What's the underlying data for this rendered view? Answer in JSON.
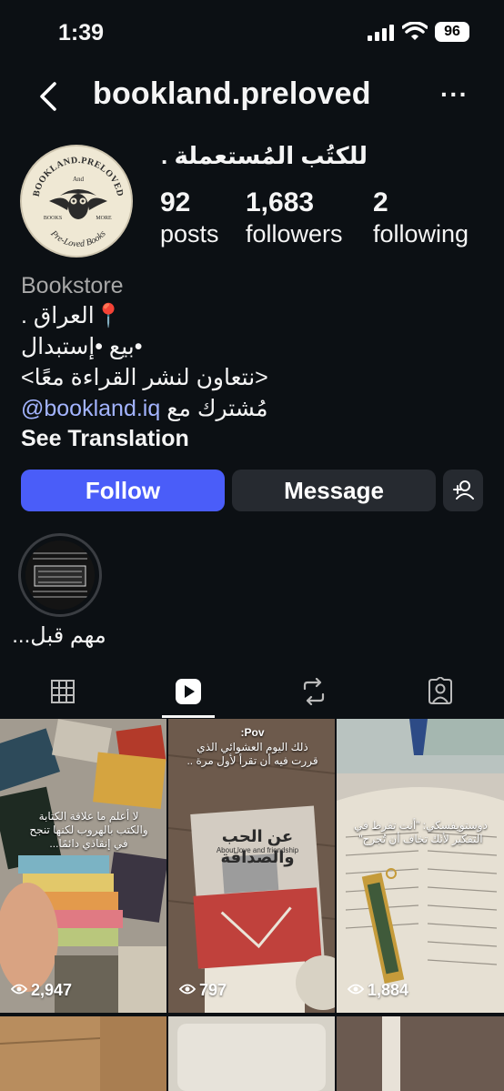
{
  "status": {
    "time": "1:39",
    "battery": "96"
  },
  "header": {
    "username": "bookland.preloved",
    "more_label": "···"
  },
  "profile": {
    "name": "للكتُب المُستعملة .",
    "avatar_text": {
      "top": "BOOKLAND.PRELOVED",
      "middle": "And",
      "left": "BOOKS",
      "right": "MORE",
      "bottom": "Pre-Loved Books"
    },
    "stats": [
      {
        "value": "92",
        "label": "posts"
      },
      {
        "value": "1,683",
        "label": "followers"
      },
      {
        "value": "2",
        "label": "following"
      }
    ]
  },
  "bio": {
    "category": "Bookstore",
    "lines": [
      "📍العراق .",
      "•بيع •إستبدال",
      "<نتعاون لنشر القراءة معًا>"
    ],
    "mention_prefix": "مُشترك مع",
    "mention": "@bookland.iq",
    "see_translation": "See Translation"
  },
  "buttons": {
    "follow": "Follow",
    "message": "Message"
  },
  "highlight": {
    "label": "مهم قبل..."
  },
  "tabs": [
    "grid",
    "reels",
    "reposts",
    "tagged"
  ],
  "grid": {
    "posts": [
      {
        "views": "2,947",
        "caption": "لا أعلم ما علاقة الكتابة والكتب بالهروب لكنها تنجح في إنقاذي دائمًا..."
      },
      {
        "views": "797",
        "caption_title": "Pov:",
        "caption": "ذلك اليوم العشوائي الذي قررت فيه أن تقرأ لأول مرة ..",
        "book_title": "عن الحب والصداقة",
        "book_sub": "About love and friendship"
      },
      {
        "views": "1,884",
        "caption": "دوستويفسكي: \"أنت تفرط في التفكير لأنك تخاف أن تُجرح\""
      }
    ]
  },
  "colors": {
    "background": "#0c1014",
    "follow": "#4a5df9",
    "button_dark": "#262a30",
    "mention": "#a3b4ff"
  }
}
